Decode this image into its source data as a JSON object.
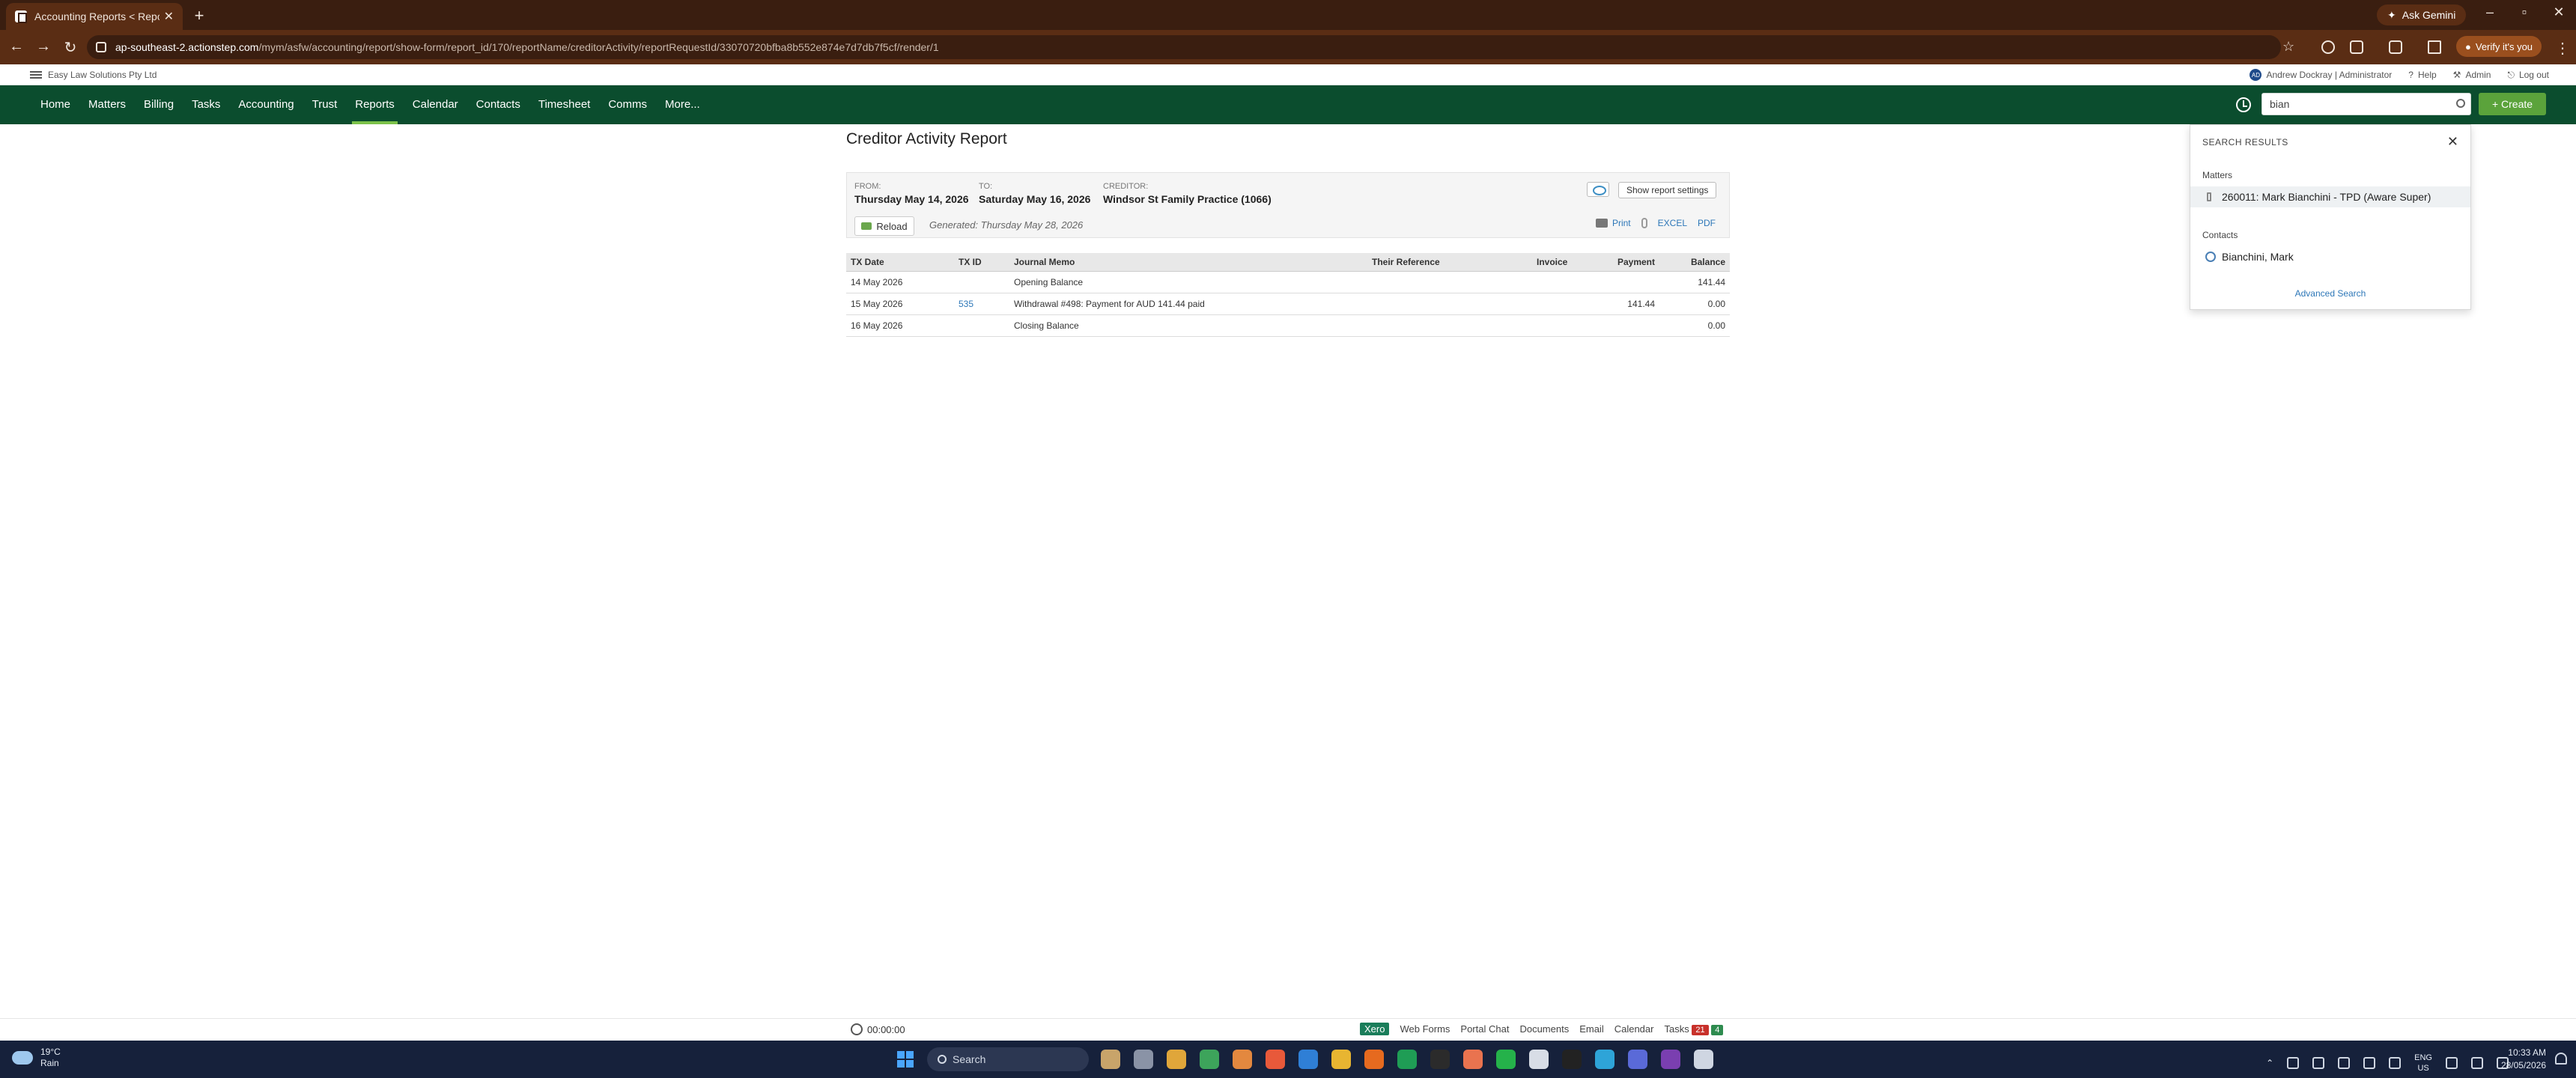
{
  "browser": {
    "tab_title": "Accounting Reports < Reports",
    "url_domain": "ap-southeast-2.actionstep.com",
    "url_path": "/mym/asfw/accounting/report/show-form/report_id/170/reportName/creditorActivity/reportRequestId/33070720bfba8b552e874e7d7db7f5cf/render/1",
    "ask_gemini": "Ask Gemini",
    "verify": "Verify it's you",
    "new_tab": "+",
    "icons": [
      "back-icon",
      "forward-icon",
      "reload-icon",
      "star-icon",
      "extensions-icon",
      "download-icon",
      "menu-icon"
    ]
  },
  "app": {
    "firm_name": "Easy Law Solutions Pty Ltd",
    "user": "Andrew Dockray | Administrator",
    "user_initials": "AD",
    "help": "Help",
    "admin": "Admin",
    "logout": "Log out",
    "nav": [
      "Home",
      "Matters",
      "Billing",
      "Tasks",
      "Accounting",
      "Trust",
      "Reports",
      "Calendar",
      "Contacts",
      "Timesheet",
      "Comms",
      "More..."
    ],
    "active_nav": "Reports",
    "search_value": "bian",
    "create_label": "+ Create",
    "brand_color": "#0b4d2e",
    "accent_color": "#5ba33b"
  },
  "report": {
    "title": "Creditor Activity Report",
    "from_label": "FROM:",
    "from_value": "Thursday May 14, 2026",
    "to_label": "TO:",
    "to_value": "Saturday May 16, 2026",
    "creditor_label": "CREDITOR:",
    "creditor_value": "Windsor St Family Practice (1066)",
    "reload_label": "Reload",
    "generated": "Generated: Thursday May 28, 2026",
    "show_settings": "Show report settings",
    "print": "Print",
    "excel": "EXCEL",
    "pdf": "PDF",
    "columns": [
      "TX Date",
      "TX ID",
      "Journal Memo",
      "Their Reference",
      "Invoice",
      "Payment",
      "Balance"
    ],
    "rows": [
      {
        "date": "14 May 2026",
        "txid": "",
        "memo": "Opening Balance",
        "ref": "",
        "invoice": "",
        "payment": "",
        "balance": "141.44"
      },
      {
        "date": "15 May 2026",
        "txid": "535",
        "memo": "Withdrawal #498: Payment for AUD 141.44 paid",
        "ref": "",
        "invoice": "",
        "payment": "141.44",
        "balance": "0.00"
      },
      {
        "date": "16 May 2026",
        "txid": "",
        "memo": "Closing Balance",
        "ref": "",
        "invoice": "",
        "payment": "",
        "balance": "0.00"
      }
    ]
  },
  "search_results": {
    "heading": "SEARCH RESULTS",
    "matters_label": "Matters",
    "matter_item": "260011: Mark Bianchini - TPD (Aware Super)",
    "contacts_label": "Contacts",
    "contact_item": "Bianchini, Mark",
    "advanced": "Advanced Search"
  },
  "footer": {
    "timer": "00:00:00",
    "xero": "Xero",
    "links": [
      "Web Forms",
      "Portal Chat",
      "Documents",
      "Email",
      "Calendar",
      "Tasks"
    ],
    "tasks_red": "21",
    "tasks_green": "4"
  },
  "taskbar": {
    "temp": "19°C",
    "weather": "Rain",
    "search": "Search",
    "lang_top": "ENG",
    "lang_bottom": "US",
    "time": "10:33 AM",
    "date": "28/05/2026"
  }
}
